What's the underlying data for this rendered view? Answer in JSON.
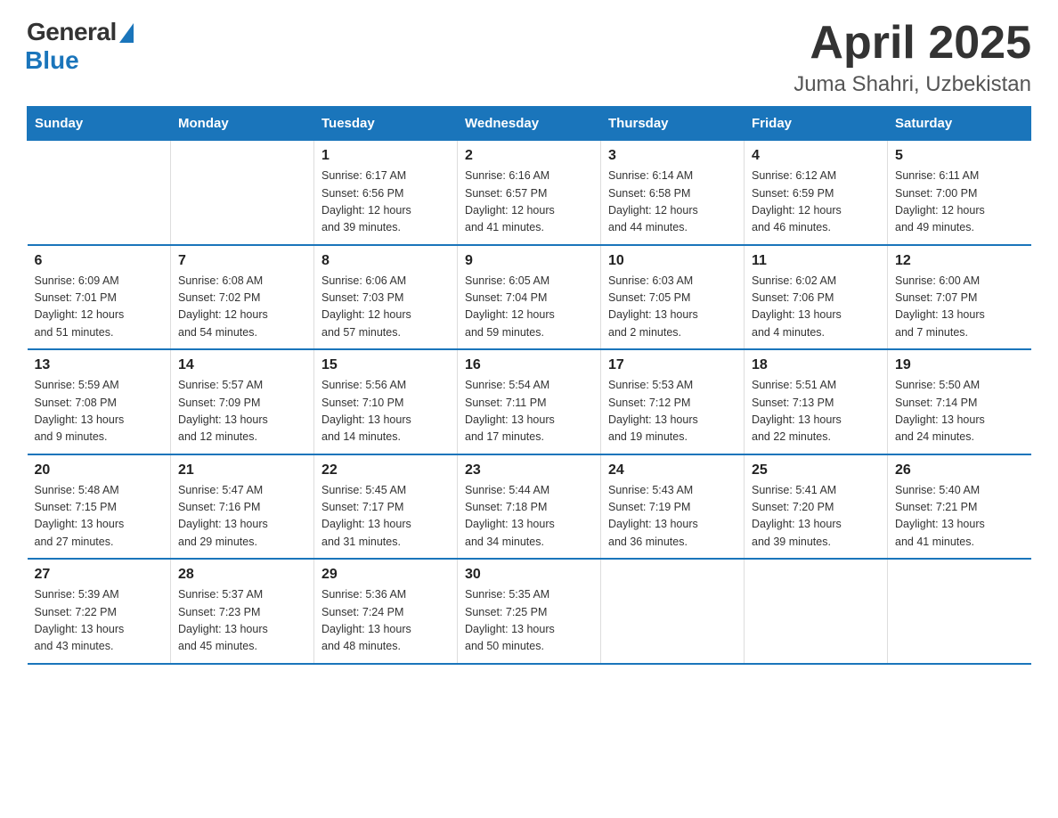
{
  "logo": {
    "general": "General",
    "blue": "Blue"
  },
  "title": "April 2025",
  "location": "Juma Shahri, Uzbekistan",
  "headers": [
    "Sunday",
    "Monday",
    "Tuesday",
    "Wednesday",
    "Thursday",
    "Friday",
    "Saturday"
  ],
  "weeks": [
    [
      {
        "day": "",
        "info": ""
      },
      {
        "day": "",
        "info": ""
      },
      {
        "day": "1",
        "info": "Sunrise: 6:17 AM\nSunset: 6:56 PM\nDaylight: 12 hours\nand 39 minutes."
      },
      {
        "day": "2",
        "info": "Sunrise: 6:16 AM\nSunset: 6:57 PM\nDaylight: 12 hours\nand 41 minutes."
      },
      {
        "day": "3",
        "info": "Sunrise: 6:14 AM\nSunset: 6:58 PM\nDaylight: 12 hours\nand 44 minutes."
      },
      {
        "day": "4",
        "info": "Sunrise: 6:12 AM\nSunset: 6:59 PM\nDaylight: 12 hours\nand 46 minutes."
      },
      {
        "day": "5",
        "info": "Sunrise: 6:11 AM\nSunset: 7:00 PM\nDaylight: 12 hours\nand 49 minutes."
      }
    ],
    [
      {
        "day": "6",
        "info": "Sunrise: 6:09 AM\nSunset: 7:01 PM\nDaylight: 12 hours\nand 51 minutes."
      },
      {
        "day": "7",
        "info": "Sunrise: 6:08 AM\nSunset: 7:02 PM\nDaylight: 12 hours\nand 54 minutes."
      },
      {
        "day": "8",
        "info": "Sunrise: 6:06 AM\nSunset: 7:03 PM\nDaylight: 12 hours\nand 57 minutes."
      },
      {
        "day": "9",
        "info": "Sunrise: 6:05 AM\nSunset: 7:04 PM\nDaylight: 12 hours\nand 59 minutes."
      },
      {
        "day": "10",
        "info": "Sunrise: 6:03 AM\nSunset: 7:05 PM\nDaylight: 13 hours\nand 2 minutes."
      },
      {
        "day": "11",
        "info": "Sunrise: 6:02 AM\nSunset: 7:06 PM\nDaylight: 13 hours\nand 4 minutes."
      },
      {
        "day": "12",
        "info": "Sunrise: 6:00 AM\nSunset: 7:07 PM\nDaylight: 13 hours\nand 7 minutes."
      }
    ],
    [
      {
        "day": "13",
        "info": "Sunrise: 5:59 AM\nSunset: 7:08 PM\nDaylight: 13 hours\nand 9 minutes."
      },
      {
        "day": "14",
        "info": "Sunrise: 5:57 AM\nSunset: 7:09 PM\nDaylight: 13 hours\nand 12 minutes."
      },
      {
        "day": "15",
        "info": "Sunrise: 5:56 AM\nSunset: 7:10 PM\nDaylight: 13 hours\nand 14 minutes."
      },
      {
        "day": "16",
        "info": "Sunrise: 5:54 AM\nSunset: 7:11 PM\nDaylight: 13 hours\nand 17 minutes."
      },
      {
        "day": "17",
        "info": "Sunrise: 5:53 AM\nSunset: 7:12 PM\nDaylight: 13 hours\nand 19 minutes."
      },
      {
        "day": "18",
        "info": "Sunrise: 5:51 AM\nSunset: 7:13 PM\nDaylight: 13 hours\nand 22 minutes."
      },
      {
        "day": "19",
        "info": "Sunrise: 5:50 AM\nSunset: 7:14 PM\nDaylight: 13 hours\nand 24 minutes."
      }
    ],
    [
      {
        "day": "20",
        "info": "Sunrise: 5:48 AM\nSunset: 7:15 PM\nDaylight: 13 hours\nand 27 minutes."
      },
      {
        "day": "21",
        "info": "Sunrise: 5:47 AM\nSunset: 7:16 PM\nDaylight: 13 hours\nand 29 minutes."
      },
      {
        "day": "22",
        "info": "Sunrise: 5:45 AM\nSunset: 7:17 PM\nDaylight: 13 hours\nand 31 minutes."
      },
      {
        "day": "23",
        "info": "Sunrise: 5:44 AM\nSunset: 7:18 PM\nDaylight: 13 hours\nand 34 minutes."
      },
      {
        "day": "24",
        "info": "Sunrise: 5:43 AM\nSunset: 7:19 PM\nDaylight: 13 hours\nand 36 minutes."
      },
      {
        "day": "25",
        "info": "Sunrise: 5:41 AM\nSunset: 7:20 PM\nDaylight: 13 hours\nand 39 minutes."
      },
      {
        "day": "26",
        "info": "Sunrise: 5:40 AM\nSunset: 7:21 PM\nDaylight: 13 hours\nand 41 minutes."
      }
    ],
    [
      {
        "day": "27",
        "info": "Sunrise: 5:39 AM\nSunset: 7:22 PM\nDaylight: 13 hours\nand 43 minutes."
      },
      {
        "day": "28",
        "info": "Sunrise: 5:37 AM\nSunset: 7:23 PM\nDaylight: 13 hours\nand 45 minutes."
      },
      {
        "day": "29",
        "info": "Sunrise: 5:36 AM\nSunset: 7:24 PM\nDaylight: 13 hours\nand 48 minutes."
      },
      {
        "day": "30",
        "info": "Sunrise: 5:35 AM\nSunset: 7:25 PM\nDaylight: 13 hours\nand 50 minutes."
      },
      {
        "day": "",
        "info": ""
      },
      {
        "day": "",
        "info": ""
      },
      {
        "day": "",
        "info": ""
      }
    ]
  ]
}
